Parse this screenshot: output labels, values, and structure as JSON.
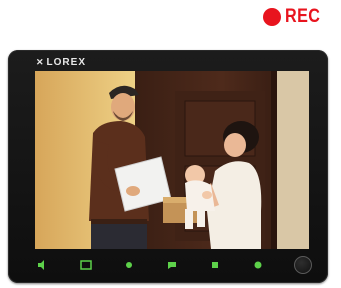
{
  "recording": {
    "label": "REC",
    "color": "#e8141e"
  },
  "monitor": {
    "brand": "LOREX",
    "control_icons": [
      "speaker-icon",
      "menu-icon",
      "brightness-icon",
      "talk-icon",
      "record-icon",
      "channel-icon",
      "power-button"
    ],
    "indicator_color": "#5dd14a"
  }
}
